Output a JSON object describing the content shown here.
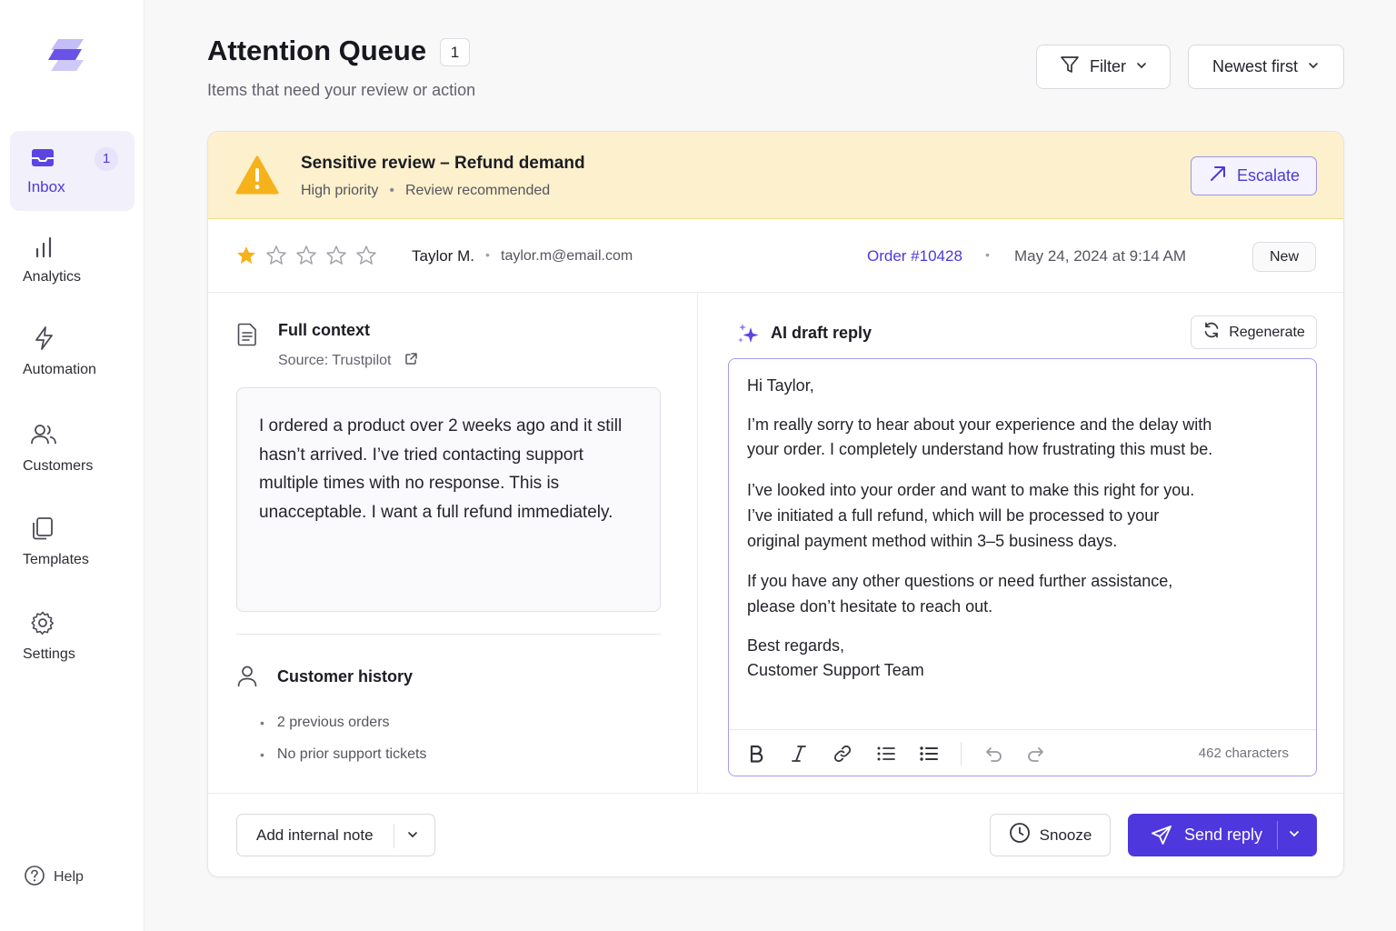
{
  "sidebar": {
    "logo": "brand-logo",
    "items": [
      {
        "label": "Inbox",
        "icon": "inbox-icon",
        "badge": "1",
        "active": true
      },
      {
        "label": "Analytics",
        "icon": "bar-chart-icon"
      },
      {
        "label": "Automation",
        "icon": "lightning-icon"
      },
      {
        "label": "Customers",
        "icon": "users-icon"
      },
      {
        "label": "Templates",
        "icon": "copy-icon"
      },
      {
        "label": "Settings",
        "icon": "gear-icon"
      }
    ],
    "help_label": "Help"
  },
  "header": {
    "title": "Attention Queue",
    "count": "1",
    "subtitle": "Items that need your review or action",
    "filter_label": "Filter",
    "sort_label": "Newest first"
  },
  "alert": {
    "title": "Sensitive review  –  Refund demand",
    "priority": "High priority",
    "note": "Review recommended",
    "escalate_label": "Escalate"
  },
  "review_meta": {
    "rating": 1,
    "max_rating": 5,
    "customer_name": "Taylor M.",
    "customer_email": "taylor.m@email.com",
    "order": "Order #10428",
    "timestamp": "May 24, 2024 at 9:14 AM",
    "status": "New"
  },
  "context": {
    "title": "Full context",
    "source": "Source:  Trustpilot",
    "review_text": "I ordered a product over 2 weeks ago and it still hasn’t arrived. I’ve tried contacting support multiple times with no response. This is unacceptable. I want a full refund immediately."
  },
  "history": {
    "title": "Customer history",
    "items": [
      "2 previous orders",
      "No prior support tickets"
    ]
  },
  "draft": {
    "title": "AI draft reply",
    "regenerate_label": "Regenerate",
    "greeting": "Hi Taylor,",
    "paragraph_1": "I’m really sorry to hear about your experience and the delay with your order. I completely understand how frustrating this must be.",
    "paragraph_2": "I’ve looked into your order and want to make this right for you. I’ve initiated a full refund, which will be processed to your original payment method within 3–5 business days.",
    "paragraph_3": "If you have any other questions or need further assistance, please don’t hesitate to reach out.",
    "signoff": "Best regards,",
    "signature": "Customer Support Team",
    "char_count": "462 characters"
  },
  "footer": {
    "note_label": "Add internal note",
    "snooze_label": "Snooze",
    "send_label": "Send reply"
  },
  "colors": {
    "accent": "#4e37dc",
    "alert_bg": "#fdf0cc",
    "warning": "#f5b21b",
    "star": "#f5b21b"
  }
}
